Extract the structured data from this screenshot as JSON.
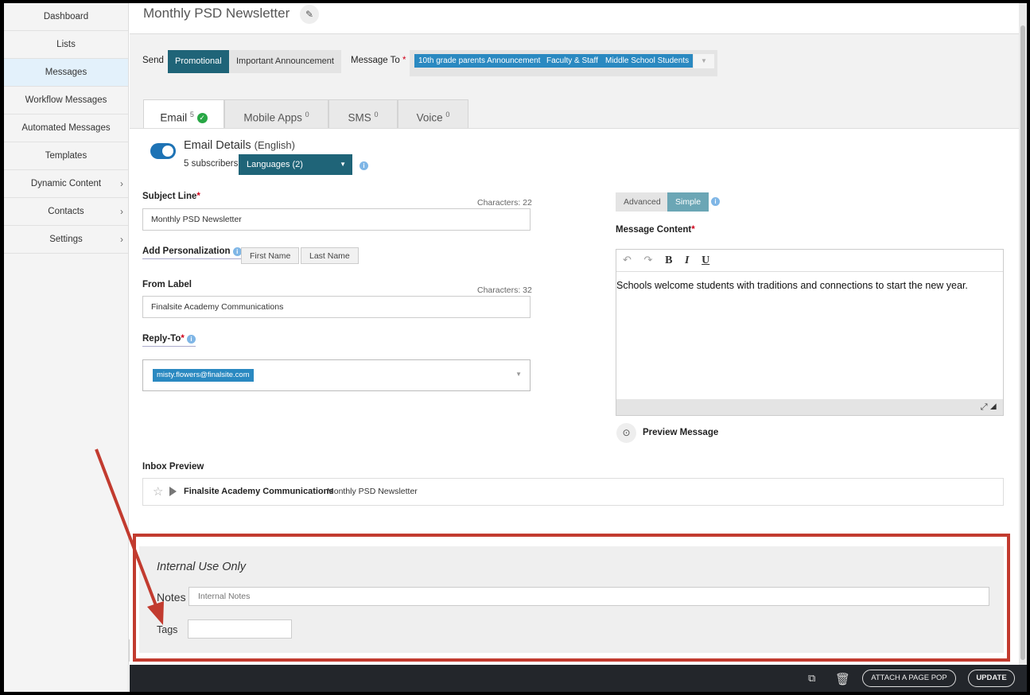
{
  "sidebar": {
    "items": [
      {
        "label": "Dashboard"
      },
      {
        "label": "Lists"
      },
      {
        "label": "Messages"
      },
      {
        "label": "Workflow Messages"
      },
      {
        "label": "Automated Messages"
      },
      {
        "label": "Templates"
      },
      {
        "label": "Dynamic Content"
      },
      {
        "label": "Contacts"
      },
      {
        "label": "Settings"
      }
    ],
    "chevron": "›"
  },
  "header": {
    "title": "Monthly PSD Newsletter"
  },
  "send": {
    "label": "Send",
    "promotional": "Promotional",
    "important": "Important Announcement",
    "message_to_label": "Message To",
    "required_mark": "*",
    "chips": [
      "10th grade parents Announcement",
      "Faculty & Staff",
      "Middle School Students"
    ]
  },
  "tabs": [
    {
      "label": "Email",
      "count": "5"
    },
    {
      "label": "Mobile Apps",
      "count": "0"
    },
    {
      "label": "SMS",
      "count": "0"
    },
    {
      "label": "Voice",
      "count": "0"
    }
  ],
  "email_details": {
    "title": "Email Details",
    "language": "(English)",
    "subscribers": "5 subscribers",
    "languages_button": "Languages (2)"
  },
  "subject": {
    "label": "Subject Line",
    "chars": "Characters: 22",
    "value": "Monthly PSD Newsletter"
  },
  "personalization": {
    "label": "Add Personalization",
    "first": "First Name",
    "last": "Last Name"
  },
  "from_label": {
    "label": "From Label",
    "chars": "Characters: 32",
    "value": "Finalsite Academy Communications"
  },
  "reply_to": {
    "label": "Reply-To",
    "chip": "misty.flowers@finalsite.com"
  },
  "editor": {
    "advanced": "Advanced",
    "simple": "Simple",
    "content_label": "Message Content",
    "body": "Schools welcome students with traditions and connections to start the new year.",
    "undo": "↶",
    "redo": "↷",
    "bold": "B",
    "italic": "I",
    "underline": "U",
    "expand": "⤢ ◢",
    "preview": "Preview Message"
  },
  "inbox_preview": {
    "label": "Inbox Preview",
    "from": "Finalsite Academy Communications",
    "subject": "Monthly PSD Newsletter"
  },
  "internal": {
    "title": "Internal Use Only",
    "notes_label": "Notes",
    "notes_placeholder": "Internal Notes",
    "tags_label": "Tags"
  },
  "footer": {
    "attach": "ATTACH A PAGE POP",
    "update": "UPDATE"
  },
  "colors": {
    "primary": "#1f6478",
    "chip": "#2a89c1",
    "highlight": "#c23b2f"
  },
  "icons": {
    "edit": "pencil-icon",
    "check": "check-circle-icon",
    "info": "info-icon",
    "star": "star-icon",
    "flag": "importance-flag-icon",
    "eye": "eye-icon",
    "folder": "move-folder-icon",
    "trash": "trash-icon"
  }
}
